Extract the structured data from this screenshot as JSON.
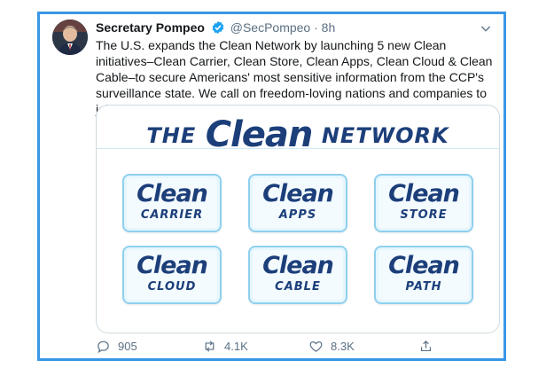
{
  "tweet": {
    "author_name": "Secretary Pompeo",
    "handle": "@SecPompeo",
    "separator": "·",
    "time": "8h",
    "text": "The U.S. expands the Clean Network by launching 5 new Clean initiatives–Clean Carrier, Clean Store, Clean Apps, Clean Cloud & Clean Cable–to secure Americans' most sensitive information from the CCP's surveillance state. We call on freedom-loving nations and companies to join us."
  },
  "image": {
    "banner_the": "THE",
    "banner_clean": "Clean",
    "banner_network": "NETWORK",
    "tiles": [
      {
        "big": "Clean",
        "small": "CARRIER"
      },
      {
        "big": "Clean",
        "small": "APPS"
      },
      {
        "big": "Clean",
        "small": "STORE"
      },
      {
        "big": "Clean",
        "small": "CLOUD"
      },
      {
        "big": "Clean",
        "small": "CABLE"
      },
      {
        "big": "Clean",
        "small": "PATH"
      }
    ]
  },
  "actions": {
    "reply_count": "905",
    "retweet_count": "4.1K",
    "like_count": "8.3K"
  },
  "colors": {
    "frame": "#3a97e6",
    "navy": "#1c3f7a",
    "tile_border": "#8fd0ee",
    "verified": "#1da1f2"
  },
  "icons": [
    "avatar",
    "verified-icon",
    "chevron-down-icon",
    "reply-icon",
    "retweet-icon",
    "like-icon",
    "share-icon"
  ]
}
